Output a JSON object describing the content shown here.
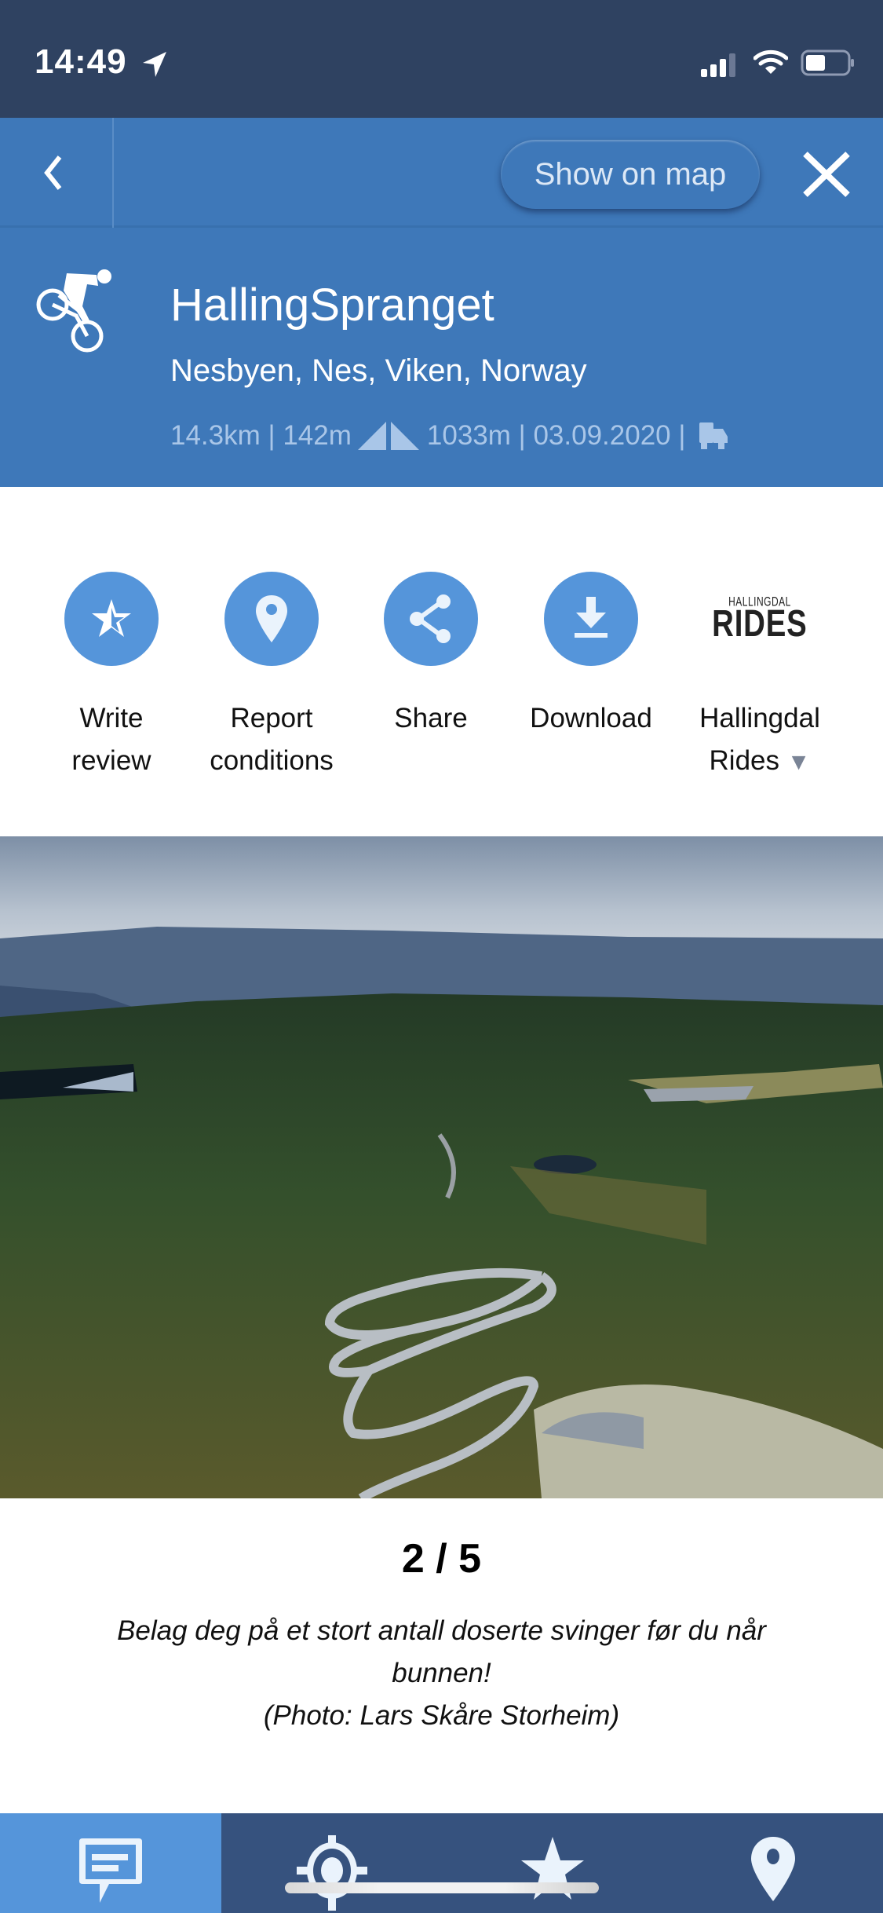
{
  "status_bar": {
    "time": "14:49"
  },
  "nav": {
    "show_on_map_label": "Show on map"
  },
  "route": {
    "title": "HallingSpranget",
    "location": "Nesbyen, Nes, Viken, Norway",
    "distance": "14.3km",
    "climb": "142m",
    "descent": "1033m",
    "date": "03.09.2020",
    "separator": " | ",
    "activity_icon": "mountain-bike-icon",
    "transport_icon": "shuttle-truck-icon"
  },
  "actions": [
    {
      "icon": "star-half-icon",
      "label_line1": "Write",
      "label_line2": "review"
    },
    {
      "icon": "map-pin-icon",
      "label_line1": "Report",
      "label_line2": "conditions"
    },
    {
      "icon": "share-icon",
      "label_line1": "Share",
      "label_line2": ""
    },
    {
      "icon": "download-icon",
      "label_line1": "Download",
      "label_line2": ""
    },
    {
      "icon": "hallingdal-rides-logo",
      "label_line1": "Hallingdal",
      "label_line2": "Rides",
      "logo_small": "HALLINGDAL",
      "logo_big": "RIDES",
      "dropdown": "▼"
    }
  ],
  "gallery": {
    "current": 2,
    "total": 5,
    "counter_text": "2 / 5",
    "caption_line1": "Belag deg på et stort antall doserte svinger før du når bunnen!",
    "caption_line2": "(Photo: Lars Skåre Storheim)"
  },
  "tabbar": {
    "tabs": [
      {
        "icon": "comments-icon",
        "active": true
      },
      {
        "icon": "locate-icon",
        "active": false
      },
      {
        "icon": "favorite-star-icon",
        "active": false
      },
      {
        "icon": "location-pin-icon",
        "active": false
      }
    ]
  },
  "colors": {
    "primary": "#3e78b9",
    "status_bar": "#2f4261",
    "action_circle": "#5595da",
    "tabbar": "#36527e"
  }
}
